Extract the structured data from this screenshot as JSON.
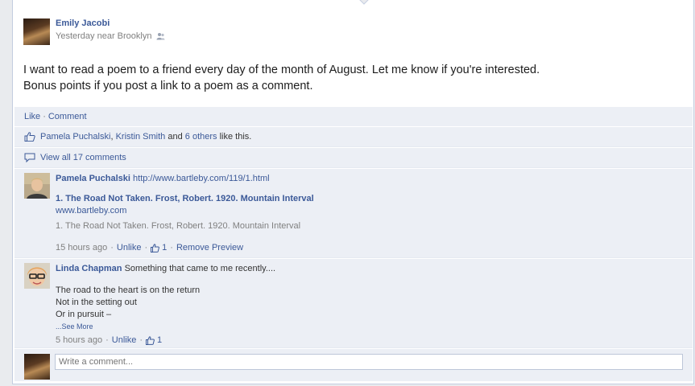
{
  "post": {
    "author": "Emily Jacobi",
    "timestamp": "Yesterday",
    "location": "near Brooklyn",
    "privacy_icon": "friends-icon",
    "message_line1": "I want to read a poem to a friend every day of the month of August. Let me know if you're interested.",
    "message_line2": "Bonus points if you post a link to a poem as a comment."
  },
  "actions": {
    "like": "Like",
    "comment": "Comment",
    "separator": "·"
  },
  "likes": {
    "name1": "Pamela Puchalski",
    "comma": ",",
    "name2": "Kristin Smith",
    "and": "and",
    "others": "6 others",
    "suffix": "like this."
  },
  "view_all": "View all 17 comments",
  "comments": [
    {
      "author": "Pamela Puchalski",
      "text": "http://www.bartleby.com/119/1.html",
      "attachment_title": "1. The Road Not Taken. Frost, Robert. 1920. Mountain Interval",
      "attachment_domain": "www.bartleby.com",
      "attachment_desc": "1. The Road Not Taken. Frost, Robert. 1920. Mountain Interval",
      "time": "15 hours ago",
      "unlike": "Unlike",
      "like_count": "1",
      "remove": "Remove Preview"
    },
    {
      "author": "Linda Chapman",
      "text": "Something that came to me recently....",
      "poem": [
        "The road to the heart is on the return",
        "Not in the setting out",
        "Or in pursuit –"
      ],
      "see_more_prefix": "...",
      "see_more": "See More",
      "time": "5 hours ago",
      "unlike": "Unlike",
      "like_count": "1"
    }
  ],
  "compose": {
    "placeholder": "Write a comment..."
  },
  "colors": {
    "link": "#3b5998",
    "ufi_background": "#eceff5",
    "page_background": "#e9ebee"
  }
}
